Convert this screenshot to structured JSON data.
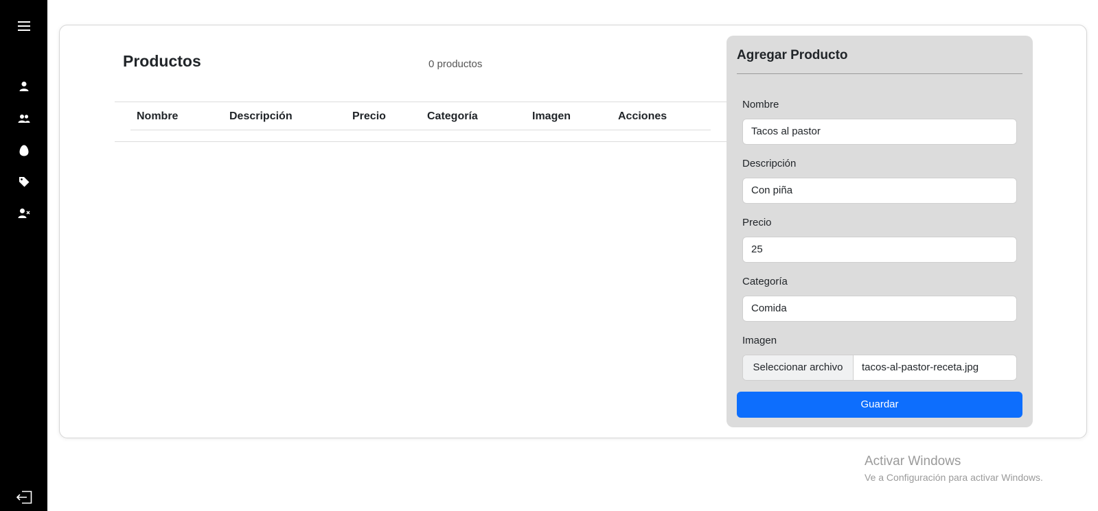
{
  "sidebar": {
    "icons": [
      "menu-icon",
      "user-icon",
      "users-icon",
      "egg-icon",
      "tag-icon",
      "user-x-icon",
      "logout-icon"
    ]
  },
  "main": {
    "title": "Productos",
    "count": "0 productos",
    "table": {
      "columns": [
        "Nombre",
        "Descripción",
        "Precio",
        "Categoría",
        "Imagen",
        "Acciones"
      ],
      "rows": []
    }
  },
  "form": {
    "title": "Agregar Producto",
    "nombre_label": "Nombre",
    "nombre_value": "Tacos al pastor",
    "descripcion_label": "Descripción",
    "descripcion_value": "Con piña",
    "precio_label": "Precio",
    "precio_value": "25",
    "categoria_label": "Categoría",
    "categoria_value": "Comida",
    "imagen_label": "Imagen",
    "file_button": "Seleccionar archivo",
    "file_name": "tacos-al-pastor-receta.jpg",
    "save_label": "Guardar"
  },
  "watermark": {
    "title": "Activar Windows",
    "subtitle": "Ve a Configuración para activar Windows."
  },
  "colors": {
    "sidebar_bg": "#000000",
    "panel_bg": "#dcdcdc",
    "primary": "#0d6efd"
  }
}
